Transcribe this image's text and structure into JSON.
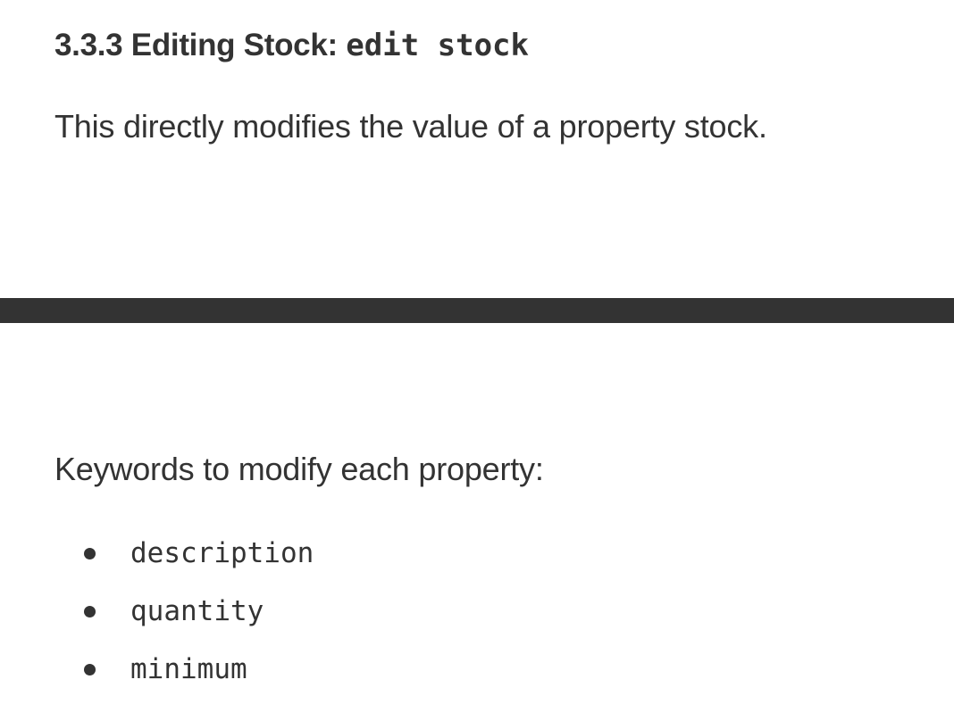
{
  "section": {
    "heading_prefix": "3.3.3 Editing Stock: ",
    "heading_code": "edit stock",
    "intro": "This directly modifies the value of a property stock."
  },
  "keywords": {
    "label": "Keywords to modify each property:",
    "items": [
      "description",
      "quantity",
      "minimum"
    ]
  },
  "colors": {
    "text": "#333333",
    "divider": "#333333",
    "background": "#ffffff"
  }
}
